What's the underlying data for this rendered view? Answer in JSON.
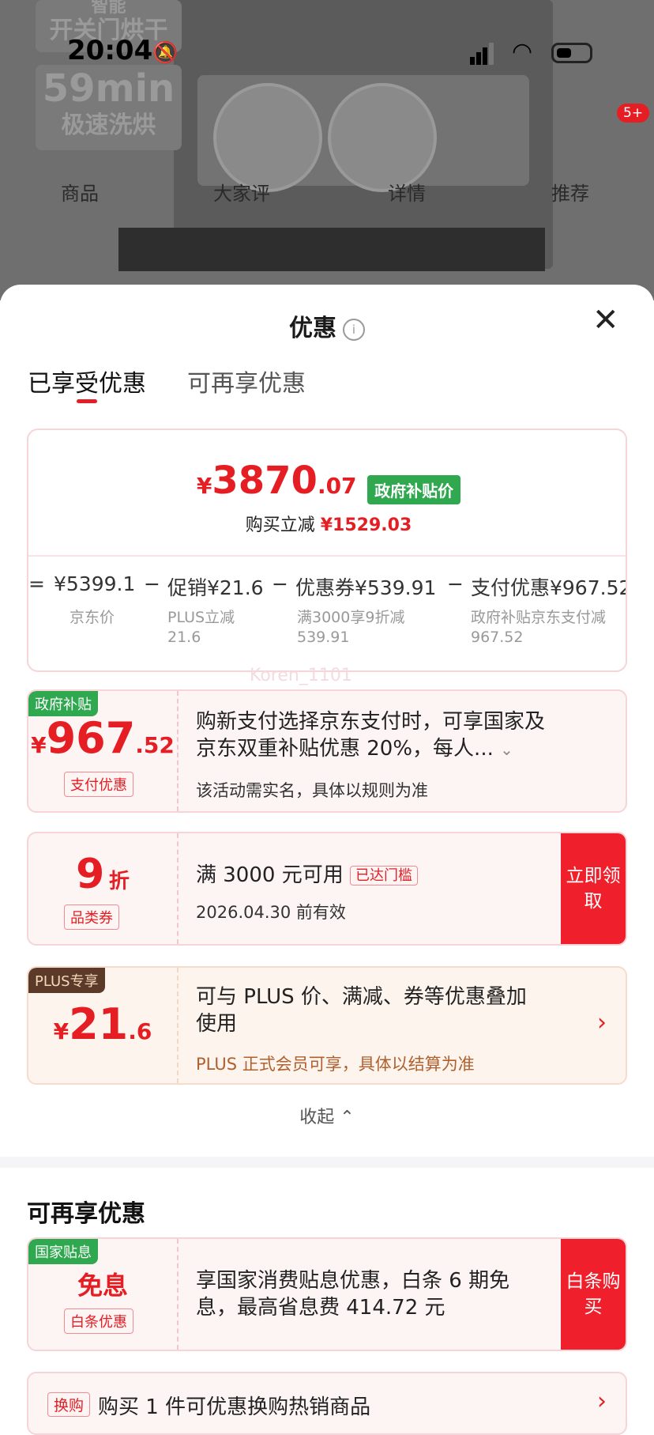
{
  "status_bar": {
    "time": "20:04",
    "notification_badge": "5+"
  },
  "background": {
    "promo_line1_top": "智能",
    "promo_line1": "开关门烘干",
    "promo_line2_big": "59min",
    "promo_line2": "极速洗烘",
    "tabs": [
      "商品",
      "大家评",
      "详情",
      "推荐"
    ]
  },
  "sheet": {
    "title": "优惠",
    "tabs": {
      "enjoyed": "已享受优惠",
      "more": "可再享优惠"
    },
    "summary": {
      "currency": "¥",
      "price_int": "3870",
      "price_dec": ".07",
      "price_tag": "政府补贴价",
      "reduce_label": "购买立减",
      "reduce_value": "¥1529.03",
      "formula": [
        {
          "op": "=",
          "value": "¥5399.1",
          "label": "京东价",
          "sub": ""
        },
        {
          "op": "−",
          "value": "促销¥21.6",
          "label": "PLUS立减",
          "sub": "21.6"
        },
        {
          "op": "−",
          "value": "优惠券¥539.91",
          "label": "满3000享9折减",
          "sub": "539.91"
        },
        {
          "op": "−",
          "value": "支付优惠¥967.52",
          "label": "政府补贴京东支付减",
          "sub": "967.52"
        }
      ],
      "watermark": "Koren_1101"
    },
    "offers": {
      "gov": {
        "corner": "政府补贴",
        "currency": "¥",
        "amount_int": "967",
        "amount_dec": ".52",
        "chip": "支付优惠",
        "text_line1": "购新支付选择京东支付时，可享国家及",
        "text_line2": "京东双重补贴优惠 20%，每人...",
        "sub": "该活动需实名，具体以规则为准"
      },
      "coupon": {
        "amount": "9",
        "unit": "折",
        "chip": "品类券",
        "text": "满 3000 元可用",
        "reached": "已达门槛",
        "sub": "2026.04.30 前有效",
        "button": "立即领取"
      },
      "plus": {
        "corner": "PLUS专享",
        "currency": "¥",
        "amount_int": "21",
        "amount_dec": ".6",
        "text_line1": "可与 PLUS 价、满减、券等优惠叠加",
        "text_line2": "使用",
        "sub": "PLUS 正式会员可享，具体以结算为准"
      }
    },
    "collapse": "收起",
    "more_section": {
      "title": "可再享优惠",
      "interest_free": {
        "corner": "国家贴息",
        "amount": "免息",
        "chip": "白条优惠",
        "text_line1": "享国家消费贴息优惠，白条 6 期免",
        "text_line2": "息，最高省息费 414.72 元",
        "button": "白条购买"
      },
      "exchange": {
        "tag": "换购",
        "text": "购买 1 件可优惠换购热销商品"
      }
    }
  }
}
